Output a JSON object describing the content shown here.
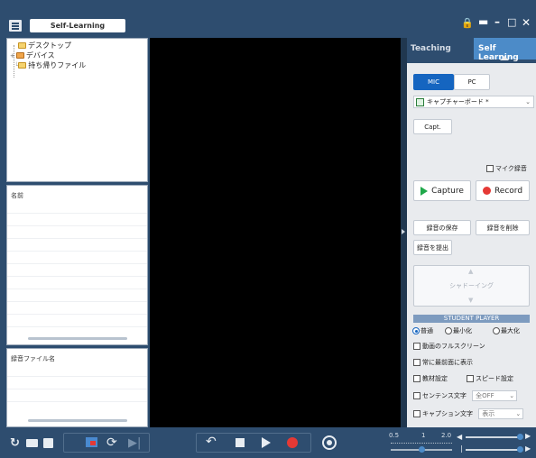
{
  "app": {
    "field_value": "Self-Learning"
  },
  "tree": {
    "items": [
      "デスクトップ",
      "デバイス",
      "持ち帰りファイル"
    ]
  },
  "name_pane": {
    "header": "名前"
  },
  "file_pane": {
    "header": "録音ファイル名"
  },
  "tabs": {
    "teaching": "Teaching",
    "self_learning": "Self Learning"
  },
  "source": {
    "mic": "MIC",
    "pc": "PC"
  },
  "device_select": {
    "value": "キャプチャーボード *"
  },
  "capt_button": "Capt.",
  "mic_record_label": "マイク録音",
  "capture_button": "Capture",
  "record_button": "Record",
  "actions": {
    "save": "録音の保存",
    "delete": "録音を削除",
    "submit": "録音を提出"
  },
  "shadowing_label": "シャドーイング",
  "student_player": {
    "header": "STUDENT PLAYER",
    "sizes": [
      "普通",
      "最小化",
      "最大化"
    ],
    "fullscreen": "動画のフルスクリーン",
    "always_on_top": "常に最前面に表示",
    "material_settings": "教材設定",
    "speed_settings": "スピード設定",
    "sentence_label": "センテンス文字",
    "sentence_value": "全OFF",
    "caption_label": "キャプション文字",
    "caption_value": "表示"
  },
  "bottom": {
    "speed_min": "0.5",
    "speed_mid": "1",
    "speed_max": "2.0"
  },
  "colors": {
    "titlebar": "#2e4d6f",
    "accent": "#4c8bc8",
    "record": "#e53935",
    "capture": "#20a84a"
  }
}
